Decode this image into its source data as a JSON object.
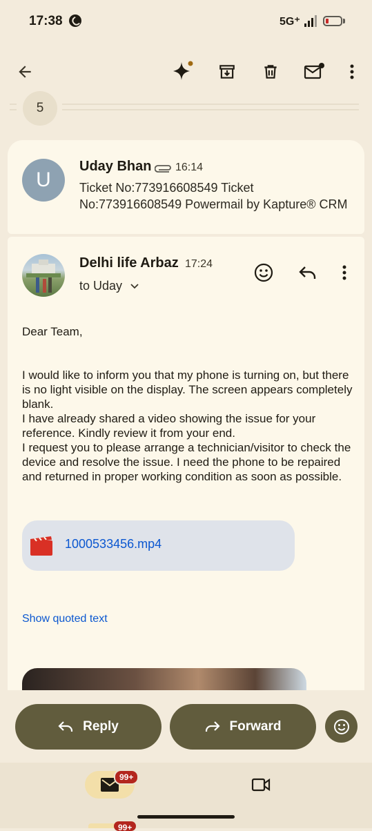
{
  "status_bar": {
    "time": "17:38",
    "network": "5G⁺"
  },
  "toolbar": {
    "back_icon": "arrow-back-icon",
    "ai_icon": "sparkle-icon",
    "archive_icon": "archive-icon",
    "delete_icon": "trash-icon",
    "unread_icon": "mark-unread-icon",
    "more_icon": "more-vert-icon"
  },
  "thread": {
    "collapsed_count": "5"
  },
  "message1": {
    "avatar_letter": "U",
    "sender": "Uday Bhan",
    "time": "16:14",
    "snippet": "Ticket No:773916608549 Ticket No:773916608549 Powermail by Kapture® CRM"
  },
  "message2": {
    "sender": "Delhi life Arbaz",
    "time": "17:24",
    "recipient": "to Uday",
    "body": [
      "Dear Team,",
      "",
      "I would like to inform you that my phone is turning on, but there is no light visible on the display. The screen appears completely blank.",
      "I have already shared a video showing the issue for your reference. Kindly review it from your end.",
      "I request you to please arrange a technician/visitor to check the device and resolve the issue. I need the phone to be repaired and returned in proper working condition as soon as possible."
    ],
    "attachment": {
      "name": "1000533456.mp4"
    },
    "show_quoted": "Show quoted text"
  },
  "actions": {
    "reply": "Reply",
    "forward": "Forward"
  },
  "nav": {
    "mail_badge": "99+",
    "mail_badge_2": "99+"
  },
  "colors": {
    "accent": "#615c3d",
    "link": "#0b57d0",
    "badge": "#b3261e",
    "background": "#f3ebdc",
    "card": "#fdf8ea"
  }
}
